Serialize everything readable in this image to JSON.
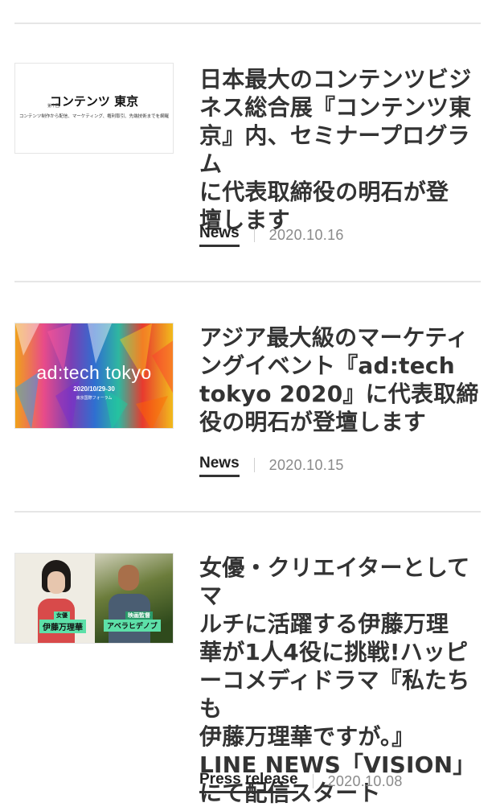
{
  "articles": [
    {
      "title_lines": [
        "日本最大のコンテンツビジ",
        "ネス総合展『コンテンツ東",
        "京』内、セミナープログラム",
        "に代表取締役の明石が登",
        "壇します"
      ],
      "category": "News",
      "date": "2020.10.16",
      "thumb": {
        "small": "第十回",
        "main": "コンテンツ 東京",
        "sub": "コンテンツ制作から配信、マーケティング、権利取引、先端技術までを網羅"
      }
    },
    {
      "title_lines": [
        "アジア最大級のマーケティ",
        "ングイベント『ad:tech",
        "tokyo 2020』に代表取締",
        "役の明石が登壇します"
      ],
      "category": "News",
      "date": "2020.10.15",
      "thumb": {
        "logo": "ad:tech tokyo",
        "dates": "2020/10/29-30",
        "venue": "東京国際フォーラム"
      }
    },
    {
      "title_lines": [
        "女優・クリエイターとしてマ",
        "ルチに活躍する伊藤万理",
        "華が1人4役に挑戦!ハッピ",
        "ーコメディドラマ『私たちも",
        "伊藤万理華ですが。』",
        "LINE NEWS「VISION」",
        "にて配信スタート"
      ],
      "category": "Press release",
      "date": "2020.10.08",
      "thumb": {
        "role1": "女優",
        "name1": "伊藤万理華",
        "role2": "映画監督",
        "name2": "アベラヒデノブ"
      }
    }
  ]
}
